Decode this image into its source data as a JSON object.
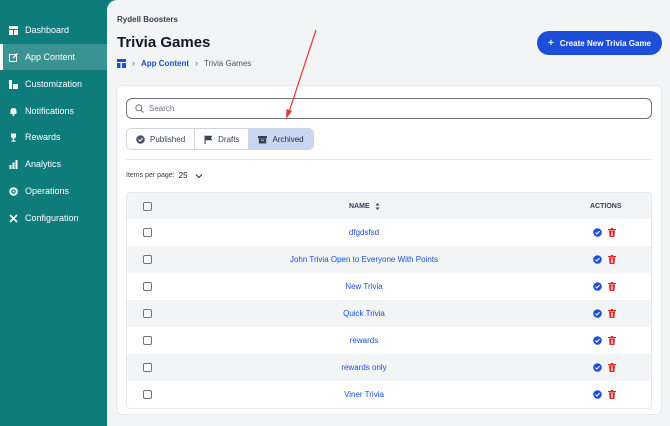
{
  "sidebar": {
    "items": [
      {
        "label": "Dashboard",
        "icon": "dashboard-icon"
      },
      {
        "label": "App Content",
        "icon": "edit-icon",
        "active": true
      },
      {
        "label": "Customization",
        "icon": "customize-icon"
      },
      {
        "label": "Notifications",
        "icon": "bell-icon"
      },
      {
        "label": "Rewards",
        "icon": "trophy-icon"
      },
      {
        "label": "Analytics",
        "icon": "bar-chart-icon"
      },
      {
        "label": "Operations",
        "icon": "gear-icon"
      },
      {
        "label": "Configuration",
        "icon": "wrench-icon"
      }
    ]
  },
  "header": {
    "org": "Rydell Boosters",
    "title": "Trivia Games",
    "breadcrumb": {
      "parent": "App Content",
      "current": "Trivia Games"
    },
    "create_label": "Create New Trivia Game"
  },
  "search": {
    "placeholder": "Search",
    "value": ""
  },
  "tabs": [
    {
      "label": "Published",
      "icon": "check-circle-icon"
    },
    {
      "label": "Drafts",
      "icon": "flag-icon"
    },
    {
      "label": "Archived",
      "icon": "archive-icon",
      "active": true
    }
  ],
  "pagination": {
    "items_label": "Items per page:",
    "items_value": "25"
  },
  "table": {
    "columns": {
      "name": "NAME",
      "actions": "ACTIONS"
    },
    "rows": [
      {
        "name": "dfgdsfsd"
      },
      {
        "name": "John Trivia Open to Everyone With Points"
      },
      {
        "name": "New Trivia"
      },
      {
        "name": "Quick Trivia"
      },
      {
        "name": "rewards"
      },
      {
        "name": "rewards only"
      },
      {
        "name": "Viner Trivia"
      }
    ]
  },
  "colors": {
    "sidebar": "#0e7c7b",
    "accent": "#1d4ed8",
    "delete": "#dc2626",
    "annotation_arrow": "#e53935"
  }
}
